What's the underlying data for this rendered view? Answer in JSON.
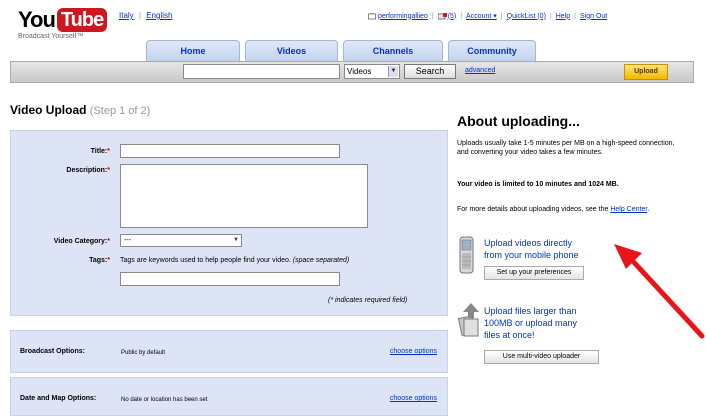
{
  "header": {
    "logo_you": "You",
    "logo_tube": "Tube",
    "tagline": "Broadcast Yourself™",
    "lang_country": "Italy",
    "lang_sep": "|",
    "lang_language": "English",
    "user": "performingallieo",
    "messages": "(5)",
    "account": "Account ▾",
    "quicklist": "QuickList (0)",
    "help": "Help",
    "signout": "Sign Out"
  },
  "tabs": [
    "Home",
    "Videos",
    "Channels",
    "Community"
  ],
  "search": {
    "value": "",
    "category": "Videos",
    "button": "Search",
    "advanced": "advanced",
    "upload": "Upload"
  },
  "page": {
    "title": "Video Upload",
    "step": "(Step 1 of 2)"
  },
  "form": {
    "title_label": "Title:",
    "title_value": "",
    "description_label": "Description:",
    "description_value": "",
    "category_label": "Video Category:",
    "category_value": "---",
    "tags_label": "Tags:",
    "tags_hint": "Tags are keywords used to help people find your video.",
    "tags_hint_note": "(space separated)",
    "tags_value": "",
    "required_note": "(* indicates required field)",
    "required_mark": "*"
  },
  "options": [
    {
      "label": "Broadcast Options:",
      "value": "Public by default",
      "link": "choose options"
    },
    {
      "label": "Date and Map Options:",
      "value": "No date or location has been set",
      "link": "choose options"
    }
  ],
  "sidebar": {
    "heading": "About uploading...",
    "p1": "Uploads usually take 1-5 minutes per MB on a high-speed connection, and converting your video takes a few minutes.",
    "p2": "Your video is limited to 10 minutes and 1024 MB.",
    "p3_text": "For more details about uploading videos, see the",
    "p3_link": "Help Center",
    "p3_end": ".",
    "mobile_link_1": "Upload videos directly",
    "mobile_link_2": "from your mobile phone",
    "mobile_button": "Set up your preferences",
    "multi_link_1": "Upload files larger than",
    "multi_link_2": "100MB or upload many",
    "multi_link_3": "files at once!",
    "multi_button": "Use multi-video uploader"
  },
  "colors": {
    "brand_red": "#cc181e",
    "link_blue": "#0033cc",
    "panel_blue": "#dce4f5",
    "upload_yellow": "#f2b900",
    "annotation_arrow": "#e8141c"
  }
}
